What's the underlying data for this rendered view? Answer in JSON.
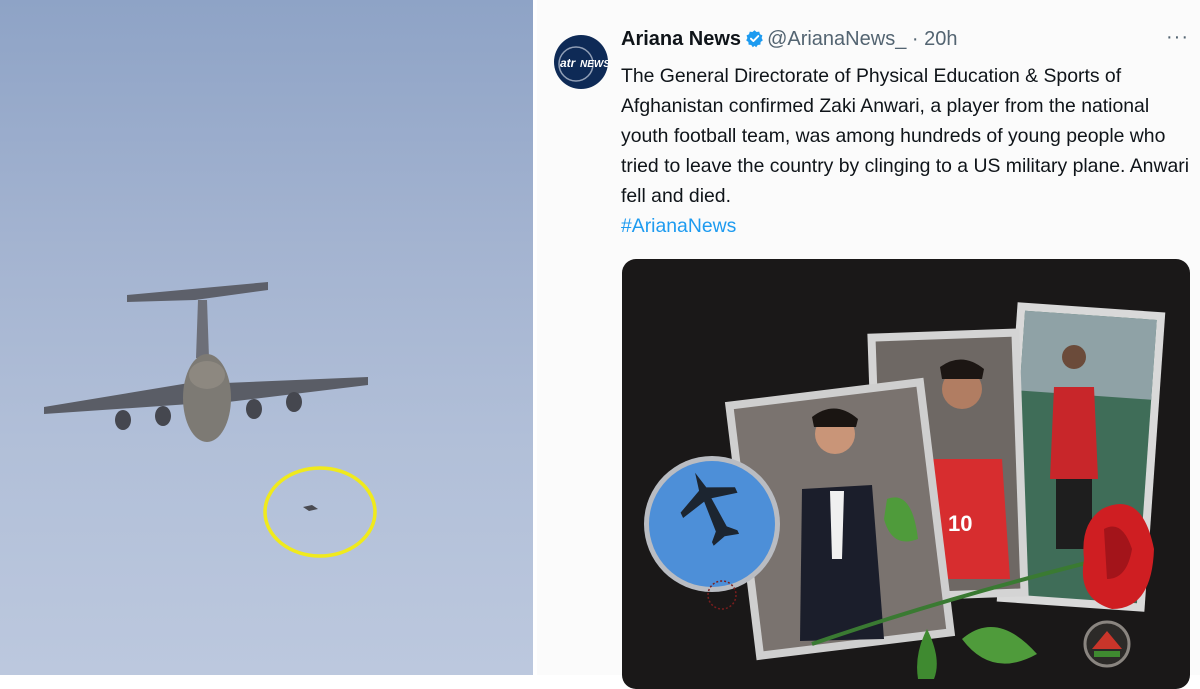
{
  "left_photo": {
    "description_icon": "airplane-with-highlight-circle-icon",
    "highlight_color": "#f0ea1c"
  },
  "tweet": {
    "avatar": {
      "logo_text": "NEWS",
      "icon": "ariana-news-logo-icon"
    },
    "display_name": "Ariana News",
    "handle": "@ArianaNews_",
    "separator": "·",
    "time": "20h",
    "more_label": "···",
    "body": "The General Directorate of Physical Education & Sports of Afghanistan confirmed Zaki Anwari, a player from the national youth football team, was among hundreds of young people who tried to leave the country by clinging to a US military plane. Anwari fell and died.",
    "hashtag": "#ArianaNews",
    "media": {
      "jersey_number": "10",
      "icons": [
        "airplane-circle-icon",
        "rose-icon",
        "emblem-icon"
      ]
    }
  },
  "colors": {
    "link": "#1d9bf0",
    "verified": "#1d9bf0",
    "text": "#0f1419",
    "muted": "#536471"
  }
}
